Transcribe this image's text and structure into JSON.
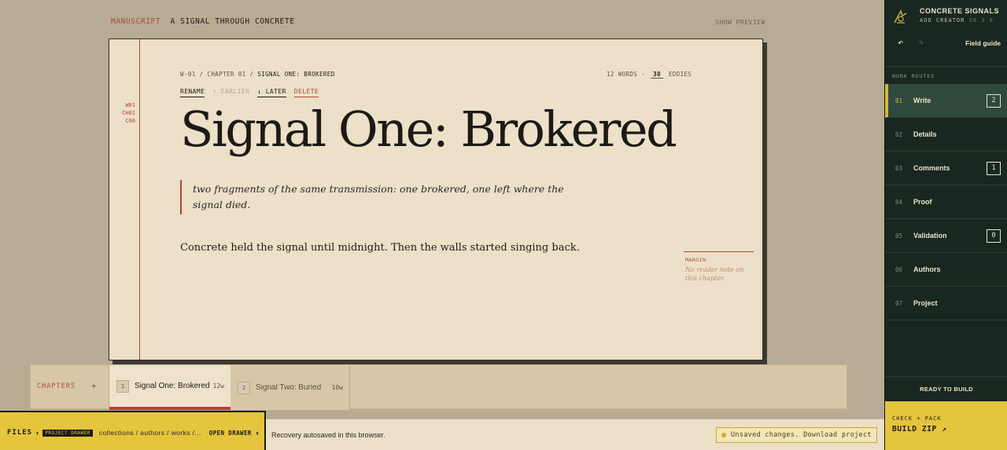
{
  "top": {
    "kicker": "MANUSCRIPT",
    "title": "A SIGNAL THROUGH CONCRETE",
    "preview_label": "SHOW PREVIEW"
  },
  "paper": {
    "gutter_codes": [
      "W01",
      "CH01",
      "C00"
    ],
    "breadcrumb_prefix": "W-01 / CHAPTER 01 / ",
    "breadcrumb_current": "SIGNAL ONE: BROKERED",
    "words_label": "12 WORDS ·",
    "eddies_count": "38",
    "eddies_label": "EDDIES",
    "actions": {
      "rename": "RENAME",
      "earlier": "↑ EARLIER",
      "later": "↓ LATER",
      "delete": "DELETE"
    },
    "chapter_title": "Signal One: Brokered",
    "epigraph": "two fragments of the same transmission: one brokered, one left where the signal died.",
    "body": "Concrete held the signal until midnight. Then the walls started singing back.",
    "margin_label": "MARGIN",
    "margin_text": "No reader note on this chapter."
  },
  "chapters": {
    "label": "CHAPTERS",
    "add_label": "+",
    "tabs": [
      {
        "num": "1",
        "name": "Signal One: Brokered",
        "words": "12w"
      },
      {
        "num": "2",
        "name": "Signal Two: Buried",
        "words": "10w"
      }
    ]
  },
  "bottom": {
    "files_label": "FILES",
    "pin_glyph": "↟",
    "drawer_badge": "PROJECT DRAWER",
    "path": "collections / authors / works /...",
    "open_drawer": "OPEN DRAWER ↟",
    "status": "Recovery autosaved in this browser.",
    "unsaved": "Unsaved changes. Download project"
  },
  "sidebar": {
    "brand_name": "CONCRETE SIGNALS",
    "brand_sub": "AOO CREATOR",
    "version": "V0.3.6",
    "undo_icon": "↶",
    "redo_icon": "↷",
    "field_guide": "Field guide",
    "routes_label": "WORK ROUTES",
    "routes": [
      {
        "num": "01",
        "label": "Write",
        "badge": "2"
      },
      {
        "num": "02",
        "label": "Details",
        "badge": ""
      },
      {
        "num": "03",
        "label": "Comments",
        "badge": "1"
      },
      {
        "num": "04",
        "label": "Proof",
        "badge": ""
      },
      {
        "num": "05",
        "label": "Validation",
        "badge": "0"
      },
      {
        "num": "06",
        "label": "Authors",
        "badge": ""
      },
      {
        "num": "07",
        "label": "Project",
        "badge": ""
      }
    ],
    "ready_label": "READY TO BUILD",
    "build_kicker": "CHECK + PACK",
    "build_label": "BUILD ZIP ↗"
  },
  "colors": {
    "background": "#b8ab94",
    "paper": "#ede0c8",
    "accent_red": "#b0443a",
    "sidebar": "#182821",
    "yellow": "#e5c53d"
  }
}
